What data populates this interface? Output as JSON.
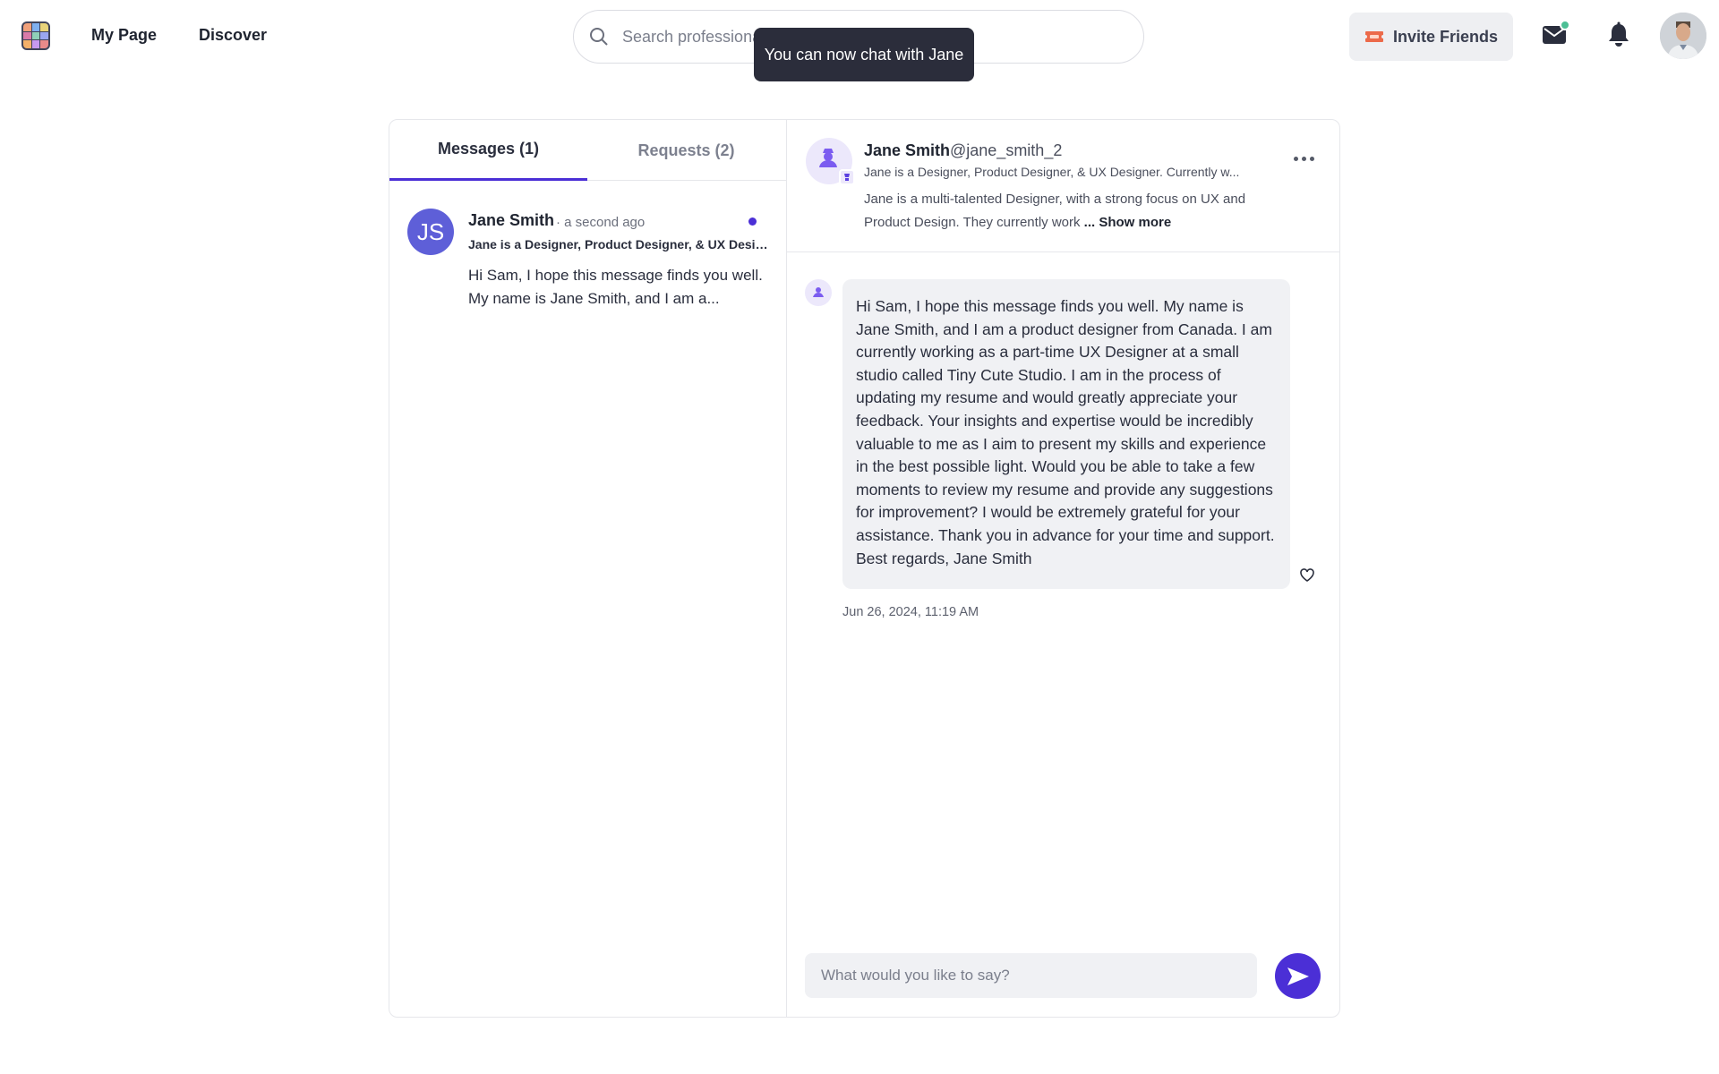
{
  "nav": {
    "my_page": "My Page",
    "discover": "Discover",
    "search_placeholder": "Search professionals",
    "invite_label": "Invite Friends"
  },
  "toast": {
    "text": "You can now chat with Jane"
  },
  "tabs": {
    "messages": "Messages  (1)",
    "requests": "Requests  (2)"
  },
  "conversations": [
    {
      "initials": "JS",
      "name": "Jane Smith",
      "time": "· a second ago",
      "subtitle": "Jane is a Designer, Product Designer, & UX Designer. Currently w...",
      "preview": "Hi Sam, I hope this message finds you well. My name is Jane Smith, and I am a...",
      "unread": true
    }
  ],
  "chat": {
    "name": "Jane Smith",
    "handle": "@jane_smith_2",
    "subtitle": "Jane is a Designer, Product Designer, & UX Designer. Currently w...",
    "bio": "Jane is a multi-talented Designer, with a strong focus on UX and Product Design. They currently work",
    "show_more": "... Show more",
    "message": "Hi Sam, I hope this message finds you well. My name is Jane Smith, and I am a product designer from Canada. I am currently working as a part-time UX Designer at a small studio called Tiny Cute Studio. I am in the process of updating my resume and would greatly appreciate your feedback. Your insights and expertise would be incredibly valuable to me as I aim to present my skills and experience in the best possible light. Would you be able to take a few moments to review my resume and provide any suggestions for improvement? I would be extremely grateful for your assistance. Thank you in advance for your time and support. Best regards, Jane Smith",
    "timestamp": "Jun 26, 2024, 11:19 AM",
    "composer_placeholder": "What would you like to say?"
  },
  "icons": {
    "logo": "app-logo-icon",
    "search": "search-icon",
    "invite": "ticket-icon",
    "mail": "mail-icon",
    "bell": "bell-icon",
    "more": "more-horizontal-icon",
    "heart": "heart-icon",
    "send": "send-icon"
  },
  "colors": {
    "accent": "#4b2fd6",
    "avatar": "#5e5fd8",
    "online": "#4dbf95",
    "toast_bg": "#2b2d3b",
    "bubble_bg": "#f0f1f4"
  }
}
